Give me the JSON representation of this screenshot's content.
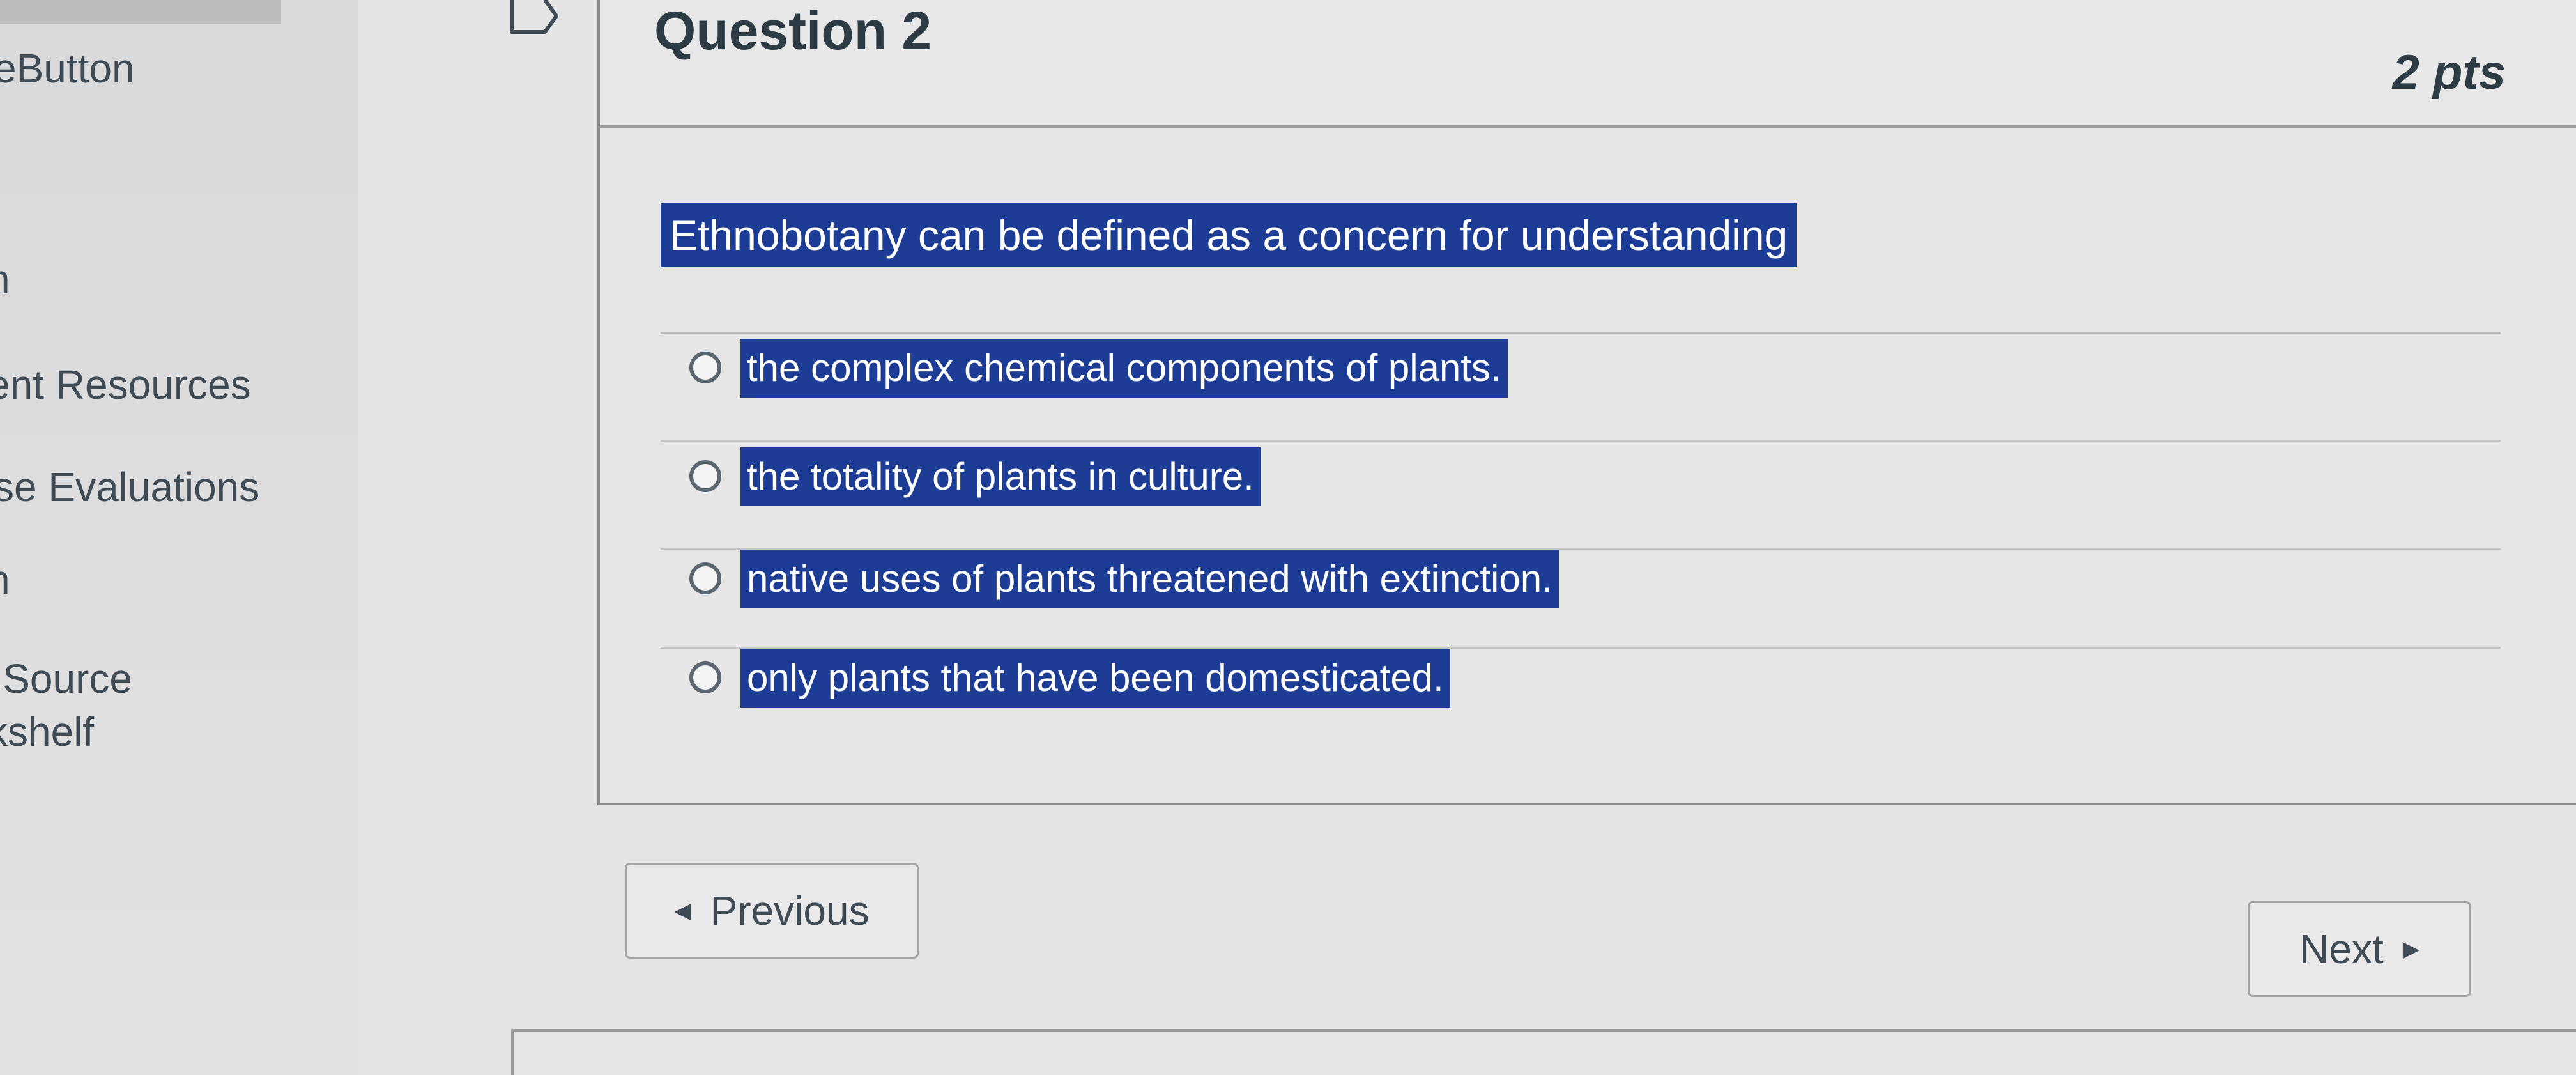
{
  "sidebar": {
    "items": [
      {
        "label": "eButton"
      },
      {
        "label": "h"
      },
      {
        "label": "ent Resources"
      },
      {
        "label": "se Evaluations"
      },
      {
        "label": "n"
      },
      {
        "label": "lSource"
      },
      {
        "label": "kshelf"
      }
    ]
  },
  "question": {
    "title": "Question 2",
    "points": "2 pts",
    "text": "Ethnobotany can be defined as a concern for understanding",
    "answers": [
      {
        "label": "the complex chemical components of plants."
      },
      {
        "label": "the totality of plants in culture."
      },
      {
        "label": "native uses of plants threatened with extinction."
      },
      {
        "label": "only plants that have been domesticated."
      }
    ]
  },
  "navigation": {
    "previous_label": "Previous",
    "next_label": "Next"
  },
  "icons": {
    "question_flag": "bookmark-flag-icon",
    "previous": "triangle-left-icon",
    "next": "triangle-right-icon"
  }
}
